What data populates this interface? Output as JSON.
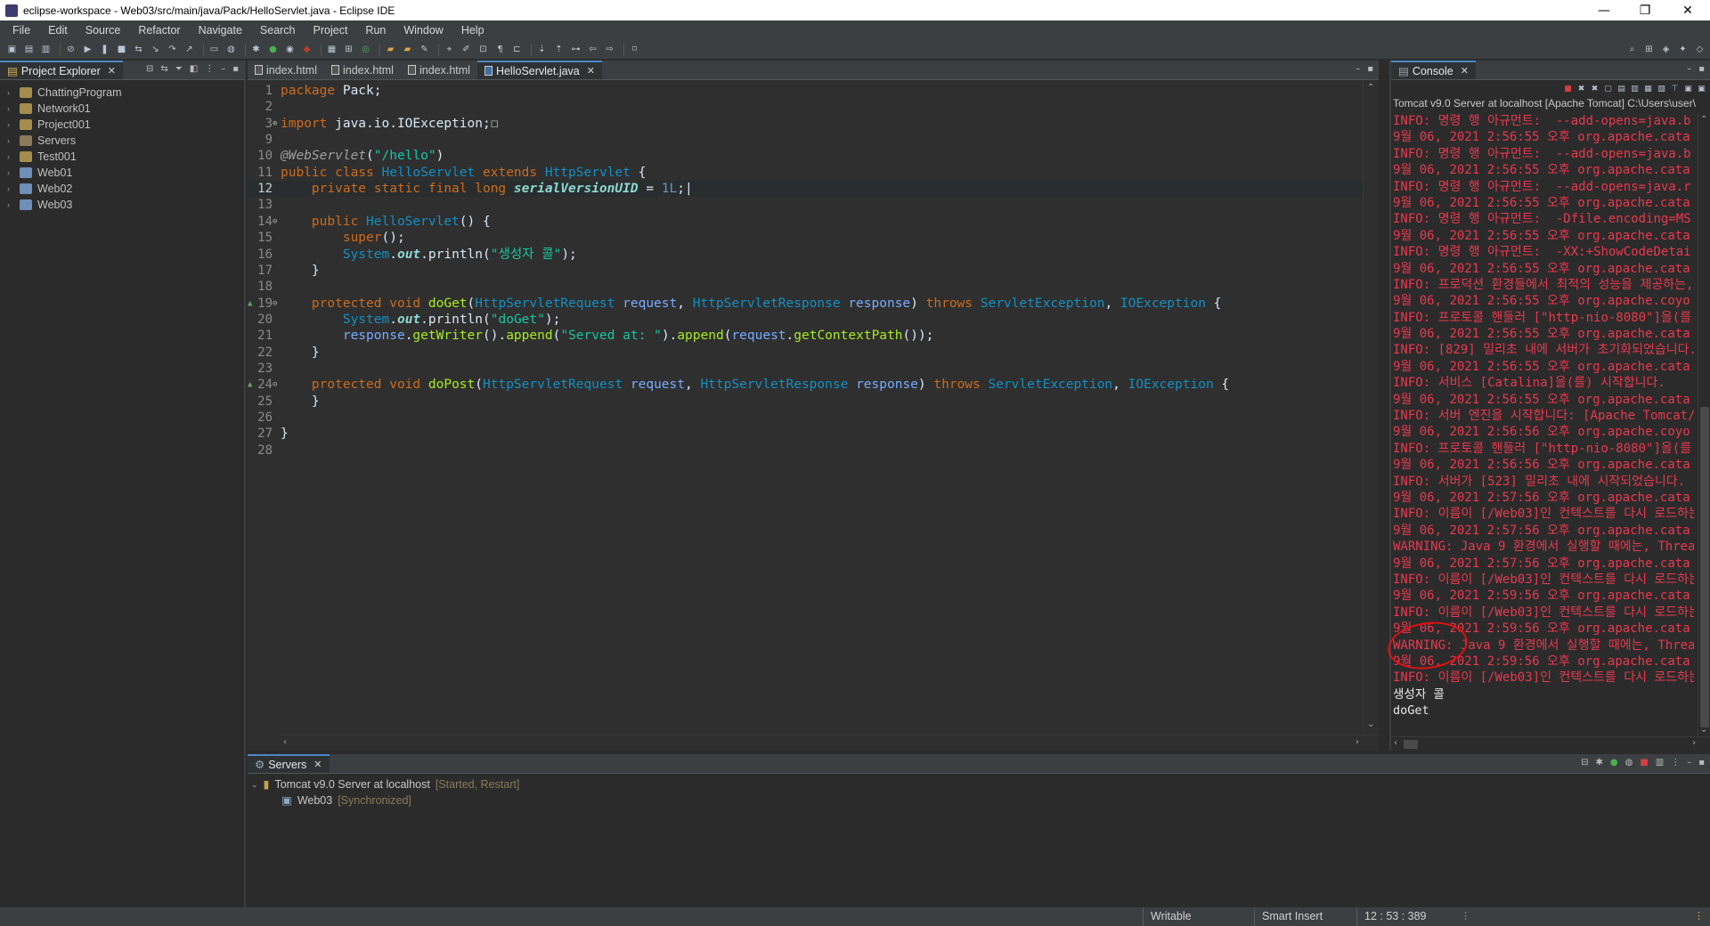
{
  "window": {
    "title": "eclipse-workspace - Web03/src/main/java/Pack/HelloServlet.java - Eclipse IDE",
    "minimize": "—",
    "maximize": "❐",
    "close": "✕"
  },
  "menu": [
    "File",
    "Edit",
    "Source",
    "Refactor",
    "Navigate",
    "Search",
    "Project",
    "Run",
    "Window",
    "Help"
  ],
  "explorer": {
    "tab_label": "Project Explorer",
    "projects": [
      {
        "name": "ChattingProgram",
        "kind": "java"
      },
      {
        "name": "Network01",
        "kind": "java"
      },
      {
        "name": "Project001",
        "kind": "java"
      },
      {
        "name": "Servers",
        "kind": "folder"
      },
      {
        "name": "Test001",
        "kind": "java"
      },
      {
        "name": "Web01",
        "kind": "web"
      },
      {
        "name": "Web02",
        "kind": "web"
      },
      {
        "name": "Web03",
        "kind": "web"
      }
    ]
  },
  "editor": {
    "tabs": [
      {
        "label": "index.html",
        "active": false
      },
      {
        "label": "index.html",
        "active": false
      },
      {
        "label": "index.html",
        "active": false
      },
      {
        "label": "HelloServlet.java",
        "active": true
      }
    ],
    "lines": [
      {
        "n": "1",
        "code": [
          [
            "kw",
            "package "
          ],
          [
            "plain",
            "Pack;"
          ]
        ]
      },
      {
        "n": "2",
        "code": []
      },
      {
        "n": "3",
        "fold": "⊕",
        "code": [
          [
            "kw",
            "import "
          ],
          [
            "plain",
            "java.io.IOException;"
          ],
          [
            "plain",
            "☐"
          ]
        ]
      },
      {
        "n": "9",
        "code": []
      },
      {
        "n": "10",
        "code": [
          [
            "ann",
            "@WebServlet"
          ],
          [
            "plain",
            "("
          ],
          [
            "str",
            "\"/hello\""
          ],
          [
            "plain",
            ")"
          ]
        ]
      },
      {
        "n": "11",
        "code": [
          [
            "kw",
            "public class "
          ],
          [
            "typ",
            "HelloServlet "
          ],
          [
            "kw",
            "extends "
          ],
          [
            "typ",
            "HttpServlet "
          ],
          [
            "plain",
            "{"
          ]
        ]
      },
      {
        "n": "12",
        "current": true,
        "code": [
          [
            "plain",
            "    "
          ],
          [
            "kw",
            "private static final long "
          ],
          [
            "fld",
            "serialVersionUID"
          ],
          [
            "plain",
            " = "
          ],
          [
            "num",
            "1L"
          ],
          [
            "plain",
            ";|"
          ]
        ]
      },
      {
        "n": "13",
        "code": []
      },
      {
        "n": "14",
        "fold": "⊖",
        "code": [
          [
            "plain",
            "    "
          ],
          [
            "kw",
            "public "
          ],
          [
            "typ",
            "HelloServlet"
          ],
          [
            "plain",
            "() {"
          ]
        ]
      },
      {
        "n": "15",
        "code": [
          [
            "plain",
            "        "
          ],
          [
            "kw",
            "super"
          ],
          [
            "plain",
            "();"
          ]
        ]
      },
      {
        "n": "16",
        "code": [
          [
            "plain",
            "        "
          ],
          [
            "typ",
            "System"
          ],
          [
            "plain",
            "."
          ],
          [
            "stat",
            "out"
          ],
          [
            "plain",
            ".println("
          ],
          [
            "str",
            "\"생성자 콜\""
          ],
          [
            "plain",
            ");"
          ]
        ]
      },
      {
        "n": "17",
        "code": [
          [
            "plain",
            "    }"
          ]
        ]
      },
      {
        "n": "18",
        "code": []
      },
      {
        "n": "19",
        "fold": "⊖",
        "override": true,
        "code": [
          [
            "plain",
            "    "
          ],
          [
            "kw",
            "protected void "
          ],
          [
            "mth",
            "doGet"
          ],
          [
            "plain",
            "("
          ],
          [
            "typ",
            "HttpServletRequest "
          ],
          [
            "var",
            "request"
          ],
          [
            "plain",
            ", "
          ],
          [
            "typ",
            "HttpServletResponse "
          ],
          [
            "var",
            "response"
          ],
          [
            "plain",
            ") "
          ],
          [
            "kw",
            "throws "
          ],
          [
            "typ",
            "ServletException"
          ],
          [
            "plain",
            ", "
          ],
          [
            "typ",
            "IOException"
          ],
          [
            "plain",
            " {"
          ]
        ]
      },
      {
        "n": "20",
        "code": [
          [
            "plain",
            "        "
          ],
          [
            "typ",
            "System"
          ],
          [
            "plain",
            "."
          ],
          [
            "stat",
            "out"
          ],
          [
            "plain",
            ".println("
          ],
          [
            "str",
            "\"doGet\""
          ],
          [
            "plain",
            ");"
          ]
        ]
      },
      {
        "n": "21",
        "code": [
          [
            "plain",
            "        "
          ],
          [
            "var",
            "response"
          ],
          [
            "plain",
            "."
          ],
          [
            "mth",
            "getWriter"
          ],
          [
            "plain",
            "()."
          ],
          [
            "mth",
            "append"
          ],
          [
            "plain",
            "("
          ],
          [
            "str",
            "\"Served at: \""
          ],
          [
            "plain",
            ")."
          ],
          [
            "mth",
            "append"
          ],
          [
            "plain",
            "("
          ],
          [
            "var",
            "request"
          ],
          [
            "plain",
            "."
          ],
          [
            "mth",
            "getContextPath"
          ],
          [
            "plain",
            "());"
          ]
        ]
      },
      {
        "n": "22",
        "code": [
          [
            "plain",
            "    }"
          ]
        ]
      },
      {
        "n": "23",
        "code": []
      },
      {
        "n": "24",
        "fold": "⊖",
        "override": true,
        "code": [
          [
            "plain",
            "    "
          ],
          [
            "kw",
            "protected void "
          ],
          [
            "mth",
            "doPost"
          ],
          [
            "plain",
            "("
          ],
          [
            "typ",
            "HttpServletRequest "
          ],
          [
            "var",
            "request"
          ],
          [
            "plain",
            ", "
          ],
          [
            "typ",
            "HttpServletResponse "
          ],
          [
            "var",
            "response"
          ],
          [
            "plain",
            ") "
          ],
          [
            "kw",
            "throws "
          ],
          [
            "typ",
            "ServletException"
          ],
          [
            "plain",
            ", "
          ],
          [
            "typ",
            "IOException"
          ],
          [
            "plain",
            " {"
          ]
        ]
      },
      {
        "n": "25",
        "code": [
          [
            "plain",
            "    }"
          ]
        ]
      },
      {
        "n": "26",
        "code": []
      },
      {
        "n": "27",
        "code": [
          [
            "plain",
            "}"
          ]
        ]
      },
      {
        "n": "28",
        "code": []
      }
    ]
  },
  "console": {
    "tab_label": "Console",
    "launch_label": "Tomcat v9.0 Server at localhost [Apache Tomcat] C:\\Users\\user\\",
    "lines": [
      {
        "kind": "err",
        "text": "INFO: 명령 행 아규먼트:  --add-opens=java.b"
      },
      {
        "kind": "err",
        "text": "9월 06, 2021 2:56:55 오후 org.apache.cata"
      },
      {
        "kind": "err",
        "text": "INFO: 명령 행 아규먼트:  --add-opens=java.b"
      },
      {
        "kind": "err",
        "text": "9월 06, 2021 2:56:55 오후 org.apache.cata"
      },
      {
        "kind": "err",
        "text": "INFO: 명령 행 아규먼트:  --add-opens=java.r"
      },
      {
        "kind": "err",
        "text": "9월 06, 2021 2:56:55 오후 org.apache.cata"
      },
      {
        "kind": "err",
        "text": "INFO: 명령 행 아규먼트:  -Dfile.encoding=MS"
      },
      {
        "kind": "err",
        "text": "9월 06, 2021 2:56:55 오후 org.apache.cata"
      },
      {
        "kind": "err",
        "text": "INFO: 명령 행 아규먼트:  -XX:+ShowCodeDetai"
      },
      {
        "kind": "err",
        "text": "9월 06, 2021 2:56:55 오후 org.apache.cata"
      },
      {
        "kind": "err",
        "text": "INFO: 프로덕션 환경들에서 최적의 성능을 제공하는, A"
      },
      {
        "kind": "err",
        "text": "9월 06, 2021 2:56:55 오후 org.apache.coyo"
      },
      {
        "kind": "err",
        "text": "INFO: 프로토콜 핸들러 [\"http-nio-8080\"]을(를"
      },
      {
        "kind": "err",
        "text": "9월 06, 2021 2:56:55 오후 org.apache.cata"
      },
      {
        "kind": "err",
        "text": "INFO: [829] 밀리초 내에 서버가 초기화되었습니다."
      },
      {
        "kind": "err",
        "text": "9월 06, 2021 2:56:55 오후 org.apache.cata"
      },
      {
        "kind": "err",
        "text": "INFO: 서비스 [Catalina]을(를) 시작합니다."
      },
      {
        "kind": "err",
        "text": "9월 06, 2021 2:56:55 오후 org.apache.cata"
      },
      {
        "kind": "err",
        "text": "INFO: 서버 엔진을 시작합니다: [Apache Tomcat/"
      },
      {
        "kind": "err",
        "text": "9월 06, 2021 2:56:56 오후 org.apache.coyo"
      },
      {
        "kind": "err",
        "text": "INFO: 프로토콜 핸들러 [\"http-nio-8080\"]을(를"
      },
      {
        "kind": "err",
        "text": "9월 06, 2021 2:56:56 오후 org.apache.cata"
      },
      {
        "kind": "err",
        "text": "INFO: 서버가 [523] 밀리초 내에 시작되었습니다."
      },
      {
        "kind": "err",
        "text": "9월 06, 2021 2:57:56 오후 org.apache.cata"
      },
      {
        "kind": "err",
        "text": "INFO: 이름이 [/Web03]인 컨텍스트를 다시 로드하는"
      },
      {
        "kind": "err",
        "text": "9월 06, 2021 2:57:56 오후 org.apache.cata"
      },
      {
        "kind": "err",
        "text": "WARNING: Java 9 환경에서 실행할 때에는, Threa"
      },
      {
        "kind": "err",
        "text": "9월 06, 2021 2:57:56 오후 org.apache.cata"
      },
      {
        "kind": "err",
        "text": "INFO: 이름이 [/Web03]인 컨텍스트를 다시 로드하는"
      },
      {
        "kind": "err",
        "text": "9월 06, 2021 2:59:56 오후 org.apache.cata"
      },
      {
        "kind": "err",
        "text": "INFO: 이름이 [/Web03]인 컨텍스트를 다시 로드하는"
      },
      {
        "kind": "err",
        "text": "9월 06, 2021 2:59:56 오후 org.apache.cata"
      },
      {
        "kind": "err",
        "text": "WARNING: Java 9 환경에서 실행할 때에는, Threa"
      },
      {
        "kind": "err",
        "text": "9월 06, 2021 2:59:56 오후 org.apache.cata"
      },
      {
        "kind": "err",
        "text": "INFO: 이름이 [/Web03]인 컨텍스트를 다시 로드하는"
      },
      {
        "kind": "out",
        "text": "생성자 콜"
      },
      {
        "kind": "out",
        "text": "doGet"
      }
    ]
  },
  "servers": {
    "tab_label": "Servers",
    "server_name": "Tomcat v9.0 Server at localhost",
    "server_status": "[Started, Restart]",
    "module_name": "Web03",
    "module_status": "[Synchronized]"
  },
  "statusbar": {
    "writable": "Writable",
    "insert_mode": "Smart Insert",
    "position": "12 : 53 : 389"
  },
  "colors": {
    "keyword": "#cc6c1d",
    "type": "#1290c3",
    "string": "#17c6a3",
    "console_error": "#e8394f",
    "annotation_circle": "#e01010"
  }
}
